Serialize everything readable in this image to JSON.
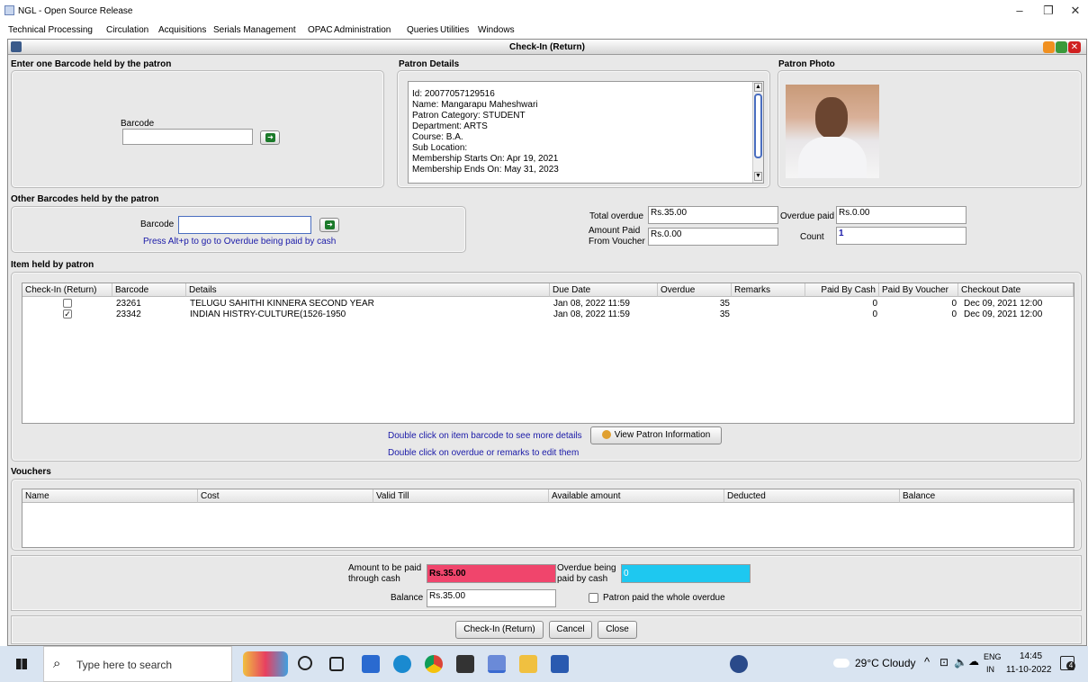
{
  "window": {
    "title": "NGL - Open Source Release"
  },
  "menu": [
    "Technical Processing",
    "Circulation",
    "Acquisitions",
    "Serials Management",
    "OPAC",
    "Administration",
    "Queries",
    "Utilities",
    "Windows"
  ],
  "frame": {
    "title": "Check-In (Return)"
  },
  "barcode_panel": {
    "header": "Enter one Barcode held by the patron",
    "label": "Barcode",
    "value": ""
  },
  "patron_details": {
    "header": "Patron Details",
    "lines": [
      "Id: 20077057129516",
      "Name: Mangarapu Maheshwari",
      "Patron Category: STUDENT",
      "Department: ARTS",
      "Course: B.A.",
      "Sub Location:",
      "Membership Starts On: Apr 19, 2021",
      "Membership Ends On: May 31, 2023"
    ]
  },
  "patron_photo": {
    "header": "Patron Photo"
  },
  "other_barcodes": {
    "header": "Other Barcodes held by the patron",
    "label": "Barcode",
    "value": "",
    "hint": "Press Alt+p to go to Overdue being paid by cash"
  },
  "summary": {
    "total_overdue_label": "Total overdue",
    "total_overdue": "Rs.35.00",
    "overdue_paid_label": "Overdue paid",
    "overdue_paid": "Rs.0.00",
    "amount_paid_label_1": "Amount Paid",
    "amount_paid_label_2": "From Voucher",
    "amount_paid": "Rs.0.00",
    "count_label": "Count",
    "count": "1"
  },
  "items": {
    "header": "Item held by patron",
    "columns": [
      "Check-In (Return)",
      "Barcode",
      "Details",
      "Due Date",
      "Overdue",
      "Remarks",
      "Paid By Cash",
      "Paid By Voucher",
      "Checkout Date"
    ],
    "rows": [
      {
        "checked": false,
        "barcode": "23261",
        "details": "TELUGU SAHITHI KINNERA SECOND YEAR",
        "due": "Jan 08, 2022 11:59",
        "overdue": "35",
        "remarks": "",
        "cash": "0",
        "voucher": "0",
        "checkout": "Dec 09, 2021 12:00"
      },
      {
        "checked": true,
        "barcode": "23342",
        "details": "INDIAN HISTRY-CULTURE(1526-1950",
        "due": "Jan 08, 2022 11:59",
        "overdue": "35",
        "remarks": "",
        "cash": "0",
        "voucher": "0",
        "checkout": "Dec 09, 2021 12:00"
      }
    ],
    "hint1": "Double click on item barcode to see more details",
    "hint2": "Double click on overdue or remarks to edit them",
    "view_patron_btn": "View Patron Information"
  },
  "vouchers": {
    "header": "Vouchers",
    "columns": [
      "Name",
      "Cost",
      "Valid Till",
      "Available amount",
      "Deducted",
      "Balance"
    ]
  },
  "payment": {
    "cash_label_1": "Amount to be paid",
    "cash_label_2": "through cash",
    "cash_value": "Rs.35.00",
    "overdue_label_1": "Overdue being",
    "overdue_label_2": "paid by cash",
    "overdue_value": "0",
    "balance_label": "Balance",
    "balance_value": "Rs.35.00",
    "whole_label": "Patron paid the whole overdue",
    "cash_color": "#f0456c",
    "overdue_color": "#1ec8f0"
  },
  "buttons": {
    "checkin": "Check-In (Return)",
    "cancel": "Cancel",
    "close": "Close"
  },
  "taskbar": {
    "search_placeholder": "Type here to search",
    "weather": "29°C  Cloudy",
    "lang1": "ENG",
    "lang2": "IN",
    "time": "14:45",
    "date": "11-10-2022",
    "notif": "4"
  }
}
